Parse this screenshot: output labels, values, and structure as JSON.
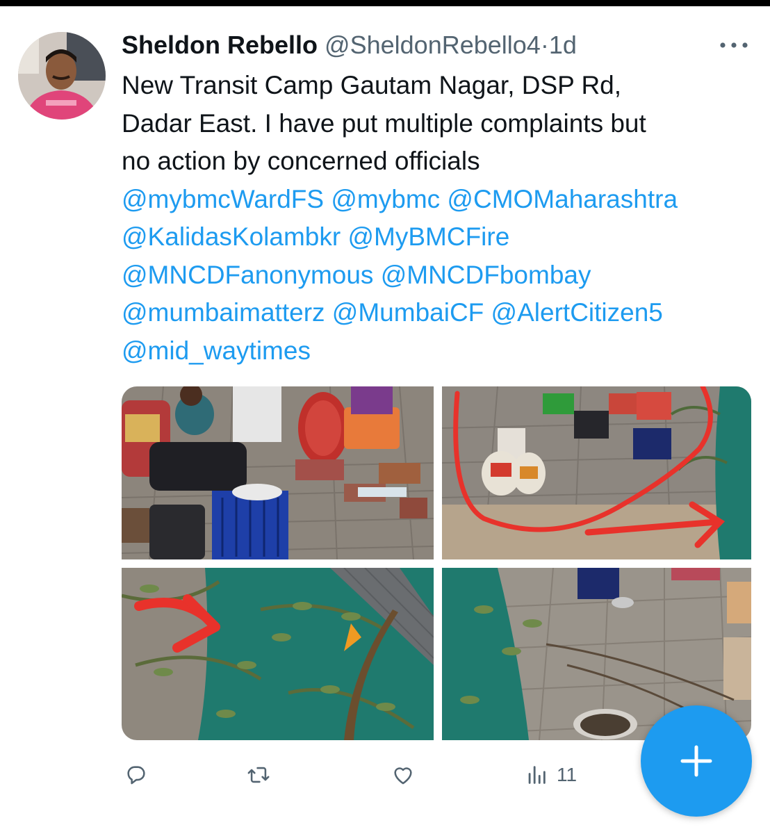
{
  "tweet": {
    "author_name": "Sheldon Rebello",
    "handle": "@SheldonRebello4",
    "separator": "·",
    "time": "1d",
    "text_lines": [
      "New Transit Camp Gautam Nagar, DSP Rd,",
      "Dadar East. I have put multiple complaints but",
      "no action by concerned officials"
    ],
    "mention_lines": [
      "@mybmcWardFS @mybmc @CMOMaharashtra",
      "@KalidasKolambkr @MyBMCFire",
      "@MNCDFanonymous @MNCDFbombay",
      "@mumbaimatterz @MumbaiCF @AlertCitizen5",
      "@mid_waytimes"
    ]
  },
  "actions": {
    "reply_icon": "reply-icon",
    "retweet_icon": "retweet-icon",
    "like_icon": "heart-icon",
    "views_icon": "views-icon",
    "views_count": "11"
  },
  "compose": {
    "icon": "plus-icon"
  },
  "colors": {
    "link": "#1d9bf0",
    "secondary_text": "#536471",
    "fab": "#1d9bf0",
    "annotation_red": "#e8322b",
    "tarp_teal": "#1f7a6e"
  }
}
